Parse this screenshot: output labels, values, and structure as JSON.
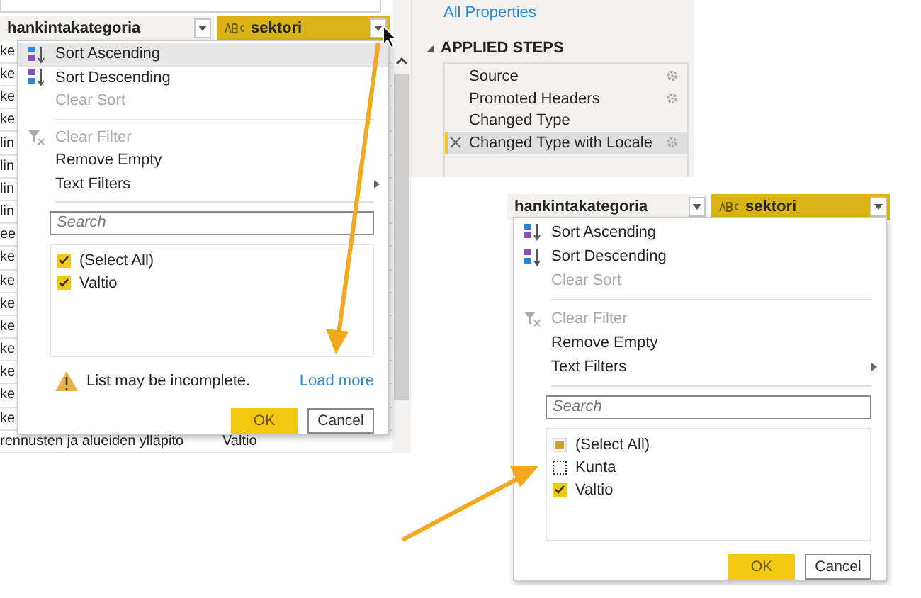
{
  "main_editor": {
    "columns": [
      {
        "label": "hankintakategoria",
        "type_icon": false,
        "highlighted": false
      },
      {
        "label": "sektori",
        "type_icon": true,
        "highlighted": true
      }
    ],
    "rows": [
      {
        "cells": [
          "ke"
        ]
      },
      {
        "cells": [
          "ke"
        ]
      },
      {
        "cells": [
          "ke"
        ]
      },
      {
        "cells": [
          "ke"
        ]
      },
      {
        "cells": [
          "lin"
        ]
      },
      {
        "cells": [
          "lin"
        ]
      },
      {
        "cells": [
          "lin"
        ]
      },
      {
        "cells": [
          "lin"
        ]
      },
      {
        "cells": [
          "ee"
        ]
      },
      {
        "cells": [
          "ke"
        ]
      },
      {
        "cells": [
          "ke"
        ]
      },
      {
        "cells": [
          "ke"
        ]
      },
      {
        "cells": [
          "ke"
        ]
      },
      {
        "cells": [
          "ke"
        ]
      },
      {
        "cells": [
          "ke"
        ]
      },
      {
        "cells": [
          "ke"
        ]
      },
      {
        "cells": [
          "ke"
        ]
      },
      {
        "cells": [
          "rennusten ja alueiden ylläpito",
          "Valtio"
        ]
      }
    ],
    "filter_menu": {
      "items": [
        {
          "label": "Sort Ascending",
          "disabled": false,
          "highlighted": true,
          "submenu": false,
          "divider_after": false
        },
        {
          "label": "Sort Descending",
          "disabled": false,
          "highlighted": false,
          "submenu": false,
          "divider_after": false
        },
        {
          "label": "Clear Sort",
          "disabled": true,
          "highlighted": false,
          "submenu": false,
          "divider_after": true
        },
        {
          "label": "Clear Filter",
          "disabled": true,
          "highlighted": false,
          "submenu": false,
          "divider_after": false
        },
        {
          "label": "Remove Empty",
          "disabled": false,
          "highlighted": false,
          "submenu": false,
          "divider_after": false
        },
        {
          "label": "Text Filters",
          "disabled": false,
          "highlighted": false,
          "submenu": true,
          "divider_after": true
        }
      ],
      "search": {
        "placeholder": "Search"
      },
      "values": [
        {
          "label": "(Select All)",
          "checked": true
        },
        {
          "label": "Valtio",
          "checked": true
        }
      ],
      "warning": {
        "text": "List may be incomplete.",
        "link": "Load more"
      },
      "buttons": [
        {
          "label": "OK",
          "primary": true
        },
        {
          "label": "Cancel",
          "primary": false
        }
      ]
    }
  },
  "query_settings": {
    "link": "All Properties",
    "section": "APPLIED STEPS",
    "steps": [
      {
        "label": "Source",
        "settings": true,
        "selected": false
      },
      {
        "label": "Promoted Headers",
        "settings": true,
        "selected": false
      },
      {
        "label": "Changed Type",
        "settings": false,
        "selected": false
      },
      {
        "label": "Changed Type with Locale",
        "settings": true,
        "selected": true
      }
    ]
  },
  "detail_view": {
    "columns": [
      {
        "label": "hankintakategoria",
        "type_icon": false,
        "highlighted": false
      },
      {
        "label": "sektori",
        "type_icon": true,
        "highlighted": true
      }
    ],
    "filter_menu": {
      "items": [
        {
          "label": "Sort Ascending",
          "disabled": false,
          "highlighted": false,
          "submenu": false,
          "divider_after": false
        },
        {
          "label": "Sort Descending",
          "disabled": false,
          "highlighted": false,
          "submenu": false,
          "divider_after": false
        },
        {
          "label": "Clear Sort",
          "disabled": true,
          "highlighted": false,
          "submenu": false,
          "divider_after": true
        },
        {
          "label": "Clear Filter",
          "disabled": true,
          "highlighted": false,
          "submenu": false,
          "divider_after": false
        },
        {
          "label": "Remove Empty",
          "disabled": false,
          "highlighted": false,
          "submenu": false,
          "divider_after": false
        },
        {
          "label": "Text Filters",
          "disabled": false,
          "highlighted": false,
          "submenu": true,
          "divider_after": true
        }
      ],
      "search": {
        "placeholder": "Search"
      },
      "values": [
        {
          "label": "(Select All)",
          "checked": false,
          "partial": true
        },
        {
          "label": "Kunta",
          "checked": false,
          "partial": false
        },
        {
          "label": "Valtio",
          "checked": true
        }
      ],
      "buttons": [
        {
          "label": "OK",
          "primary": true
        },
        {
          "label": "Cancel",
          "primary": false
        }
      ]
    }
  }
}
